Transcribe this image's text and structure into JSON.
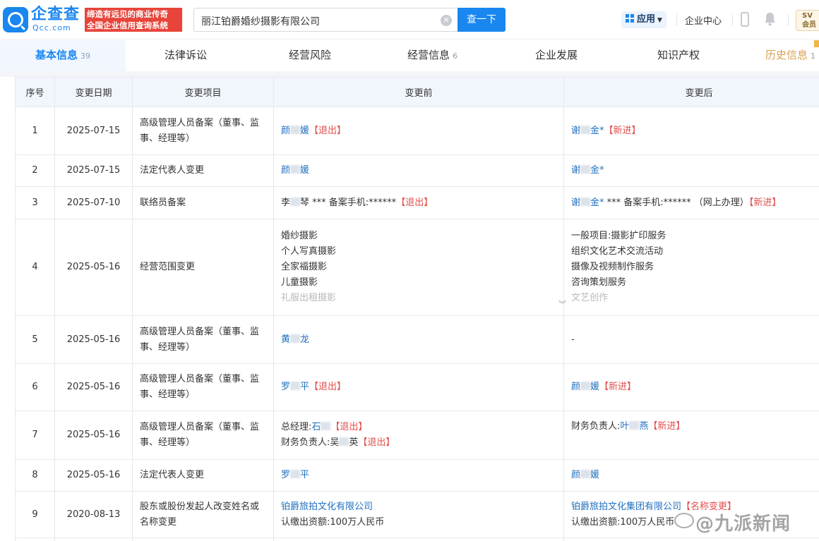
{
  "header": {
    "logo_text": "企查查",
    "logo_sub": "Qcc.com",
    "slogan_line1": "缔造有远见的商业传奇",
    "slogan_line2": "全国企业信用查询系统",
    "search_value": "丽江铂爵婚纱摄影有限公司",
    "search_button": "查一下",
    "app_menu": "应用",
    "enterprise_center": "企业中心",
    "vip_line1": "SV",
    "vip_line2": "会员"
  },
  "tabs": [
    {
      "label": "基本信息",
      "count": "39"
    },
    {
      "label": "法律诉讼",
      "count": ""
    },
    {
      "label": "经营风险",
      "count": ""
    },
    {
      "label": "经营信息",
      "count": "6"
    },
    {
      "label": "企业发展",
      "count": ""
    },
    {
      "label": "知识产权",
      "count": ""
    },
    {
      "label": "历史信息",
      "count": "1"
    }
  ],
  "table": {
    "headers": [
      "序号",
      "变更日期",
      "变更项目",
      "变更前",
      "变更后"
    ],
    "rows": [
      {
        "no": "1",
        "date": "2025-07-15",
        "item": "高级管理人员备案（董事、监事、经理等）",
        "before": {
          "name_a": "颜",
          "name_b": "媛",
          "tag": "【退出】"
        },
        "after": {
          "name_a": "谢",
          "name_b": "金*",
          "tag": "【新进】"
        }
      },
      {
        "no": "2",
        "date": "2025-07-15",
        "item": "法定代表人变更",
        "before": {
          "name_a": "颜",
          "name_b": "媛"
        },
        "after": {
          "name_a": "谢",
          "name_b": "金*"
        }
      },
      {
        "no": "3",
        "date": "2025-07-10",
        "item": "联络员备案",
        "before": {
          "name_a": "李",
          "name_b": "琴",
          "detail": " *** 备案手机:******",
          "tag": "【退出】"
        },
        "after": {
          "name_a": "谢",
          "name_b": "金*",
          "detail": " *** 备案手机:******  （网上办理）",
          "tag": "【新进】"
        }
      },
      {
        "no": "4",
        "date": "2025-05-16",
        "item": "经营范围变更",
        "before_lines": [
          "婚纱摄影",
          "个人写真摄影",
          "全家福摄影",
          "儿童摄影",
          "礼服出租摄影"
        ],
        "after_lines": [
          "一般项目:摄影扩印服务",
          "组织文化艺术交流活动",
          "摄像及视频制作服务",
          "咨询策划服务",
          "文艺创作"
        ]
      },
      {
        "no": "5",
        "date": "2025-05-16",
        "item": "高级管理人员备案（董事、监事、经理等）",
        "before": {
          "name_a": "黄",
          "name_b": "龙"
        },
        "after": {
          "text": "-"
        }
      },
      {
        "no": "6",
        "date": "2025-05-16",
        "item": "高级管理人员备案（董事、监事、经理等）",
        "before": {
          "name_a": "罗",
          "name_b": "平",
          "tag": "【退出】"
        },
        "after": {
          "name_a": "颜",
          "name_b": "媛",
          "tag": "【新进】"
        }
      },
      {
        "no": "7",
        "date": "2025-05-16",
        "item": "高级管理人员备案（董事、监事、经理等）",
        "before": {
          "line1_label": "总经理:",
          "line1_name": "石",
          "line1_tag": "【退出】",
          "line2_label": "财务负责人:吴",
          "line2_name": "英",
          "line2_tag": "【退出】"
        },
        "after": {
          "label": "财务负责人:",
          "name_a": "叶",
          "name_b": "燕",
          "tag": "【新进】"
        }
      },
      {
        "no": "8",
        "date": "2025-05-16",
        "item": "法定代表人变更",
        "before": {
          "name_a": "罗",
          "name_b": "平"
        },
        "after": {
          "name_a": "颜",
          "name_b": "媛"
        }
      },
      {
        "no": "9",
        "date": "2020-08-13",
        "item": "股东或股份发起人改变姓名或名称变更",
        "before": {
          "company": "铂爵旅拍文化有限公司",
          "capital": "认缴出资额:100万人民币"
        },
        "after": {
          "company": "铂爵旅拍文化集团有限公司",
          "tag": "【名称变更】",
          "capital": "认缴出资额:100万人民币"
        }
      }
    ]
  },
  "watermark": "@九派新闻",
  "colors": {
    "brand": "#1a86f0",
    "link": "#1f6fbf",
    "tag_red": "#e34d4d",
    "header_bg": "#f1f6fd"
  }
}
